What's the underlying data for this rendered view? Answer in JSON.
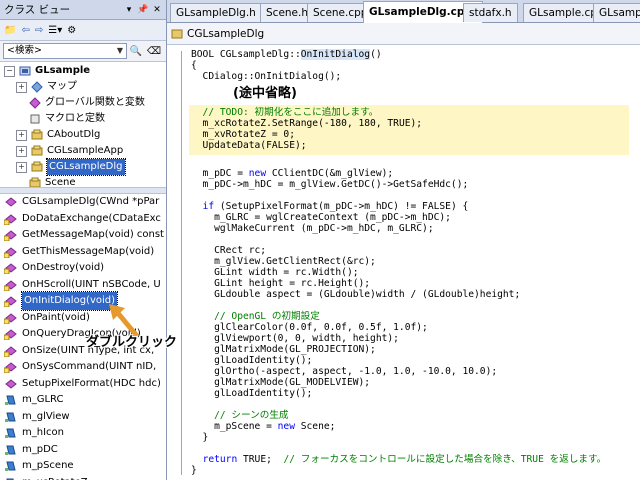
{
  "class_view": {
    "title": "クラス ビュー",
    "search_placeholder": "<検索>",
    "tree": [
      {
        "label": "GLsample",
        "level": 0,
        "expander": "−",
        "icon": "project-icon",
        "bold": true
      },
      {
        "label": "マップ",
        "level": 1,
        "expander": "+",
        "icon": "map-icon"
      },
      {
        "label": "グローバル関数と変数",
        "level": 1,
        "expander": "",
        "icon": "global-functions-icon"
      },
      {
        "label": "マクロと定数",
        "level": 1,
        "expander": "",
        "icon": "macro-icon"
      },
      {
        "label": "CAboutDlg",
        "level": 1,
        "expander": "+",
        "icon": "class-icon"
      },
      {
        "label": "CGLsampleApp",
        "level": 1,
        "expander": "+",
        "icon": "class-icon"
      },
      {
        "label": "CGLsampleDlg",
        "level": 1,
        "expander": "+",
        "icon": "class-icon",
        "selected": true
      },
      {
        "label": "Scene",
        "level": 1,
        "expander": "",
        "icon": "class-icon"
      }
    ],
    "members": [
      {
        "label": "CGLsampleDlg(CWnd *pPar",
        "icon": "method-icon"
      },
      {
        "label": "DoDataExchange(CDataExc",
        "icon": "method-protected-icon"
      },
      {
        "label": "GetMessageMap(void) const",
        "icon": "method-protected-icon"
      },
      {
        "label": "GetThisMessageMap(void)",
        "icon": "method-protected-icon"
      },
      {
        "label": "OnDestroy(void)",
        "icon": "method-protected-icon"
      },
      {
        "label": "OnHScroll(UINT nSBCode, U",
        "icon": "method-protected-icon"
      },
      {
        "label": "OnInitDialog(void)",
        "icon": "method-protected-icon",
        "selected": true
      },
      {
        "label": "OnPaint(void)",
        "icon": "method-protected-icon"
      },
      {
        "label": "OnQueryDragIcon(void)",
        "icon": "method-protected-icon"
      },
      {
        "label": "OnSize(UINT nType, int cx,",
        "icon": "method-protected-icon"
      },
      {
        "label": "OnSysCommand(UINT nID,",
        "icon": "method-protected-icon"
      },
      {
        "label": "SetupPixelFormat(HDC hdc)",
        "icon": "method-icon"
      },
      {
        "label": "m_GLRC",
        "icon": "field-icon"
      },
      {
        "label": "m_glView",
        "icon": "field-icon"
      },
      {
        "label": "m_hIcon",
        "icon": "field-icon"
      },
      {
        "label": "m_pDC",
        "icon": "field-icon"
      },
      {
        "label": "m_pScene",
        "icon": "field-icon"
      },
      {
        "label": "m_xcRotateZ",
        "icon": "field-icon"
      }
    ]
  },
  "tabs": [
    {
      "label": "GLsampleDlg.h",
      "active": false
    },
    {
      "label": "Scene.h",
      "active": false
    },
    {
      "label": "Scene.cpp",
      "active": false
    },
    {
      "label": "GLsampleDlg.cpp*",
      "active": true
    },
    {
      "label": "stdafx.h",
      "active": false
    },
    {
      "label": "GLsample.cpp",
      "active": false
    },
    {
      "label": "GLsample",
      "active": false
    }
  ],
  "nav_bar": {
    "label": "CGLsampleDlg"
  },
  "code_lines": [
    [
      {
        "t": "BOOL CGLsampleDlg::",
        "c": ""
      },
      {
        "t": "OnInitDialog",
        "c": "hl"
      },
      {
        "t": "()",
        "c": ""
      }
    ],
    [
      {
        "t": "{",
        "c": ""
      }
    ],
    [
      {
        "t": "  CDialog::OnInitDialog();",
        "c": ""
      }
    ],
    [
      {
        "t": "",
        "c": ""
      }
    ],
    [
      {
        "t": "",
        "c": ""
      }
    ],
    [
      {
        "t": "  // TODO: 初期化をここに追加します。",
        "c": "cm"
      }
    ],
    [
      {
        "t": "  m_xcRotateZ.SetRange(-180, 180, ",
        "c": ""
      },
      {
        "t": "TRUE",
        "c": ""
      },
      {
        "t": ");",
        "c": ""
      }
    ],
    [
      {
        "t": "  m_xvRotateZ = 0;",
        "c": ""
      }
    ],
    [
      {
        "t": "  UpdateData(FALSE);",
        "c": ""
      }
    ],
    [
      {
        "t": "",
        "c": ""
      }
    ],
    [
      {
        "t": "  m_pDC = ",
        "c": ""
      },
      {
        "t": "new",
        "c": "kw"
      },
      {
        "t": " CClientDC(&m_glView);",
        "c": ""
      }
    ],
    [
      {
        "t": "  m_pDC->m_hDC = m_glView.GetDC()->GetSafeHdc();",
        "c": ""
      }
    ],
    [
      {
        "t": "",
        "c": ""
      }
    ],
    [
      {
        "t": "  ",
        "c": ""
      },
      {
        "t": "if",
        "c": "kw"
      },
      {
        "t": " (SetupPixelFormat(m_pDC->m_hDC) != FALSE) {",
        "c": ""
      }
    ],
    [
      {
        "t": "    m_GLRC = wglCreateContext (m_pDC->m_hDC);",
        "c": ""
      }
    ],
    [
      {
        "t": "    wglMakeCurrent (m_pDC->m_hDC, m_GLRC);",
        "c": ""
      }
    ],
    [
      {
        "t": "",
        "c": ""
      }
    ],
    [
      {
        "t": "    CRect rc;",
        "c": ""
      }
    ],
    [
      {
        "t": "    m_glView.GetClientRect(&rc);",
        "c": ""
      }
    ],
    [
      {
        "t": "    GLint width = rc.Width();",
        "c": ""
      }
    ],
    [
      {
        "t": "    GLint height = rc.Height();",
        "c": ""
      }
    ],
    [
      {
        "t": "    GLdouble aspect = (GLdouble)width / (GLdouble)height;",
        "c": ""
      }
    ],
    [
      {
        "t": "",
        "c": ""
      }
    ],
    [
      {
        "t": "    // OpenGL の初期設定",
        "c": "cm"
      }
    ],
    [
      {
        "t": "    glClearColor(0.0f, 0.0f, 0.5f, 1.0f);",
        "c": ""
      }
    ],
    [
      {
        "t": "    glViewport(0, 0, width, height);",
        "c": ""
      }
    ],
    [
      {
        "t": "    glMatrixMode(GL_PROJECTION);",
        "c": ""
      }
    ],
    [
      {
        "t": "    glLoadIdentity();",
        "c": ""
      }
    ],
    [
      {
        "t": "    glOrtho(-aspect, aspect, -1.0, 1.0, -10.0, 10.0);",
        "c": ""
      }
    ],
    [
      {
        "t": "    glMatrixMode(GL_MODELVIEW);",
        "c": ""
      }
    ],
    [
      {
        "t": "    glLoadIdentity();",
        "c": ""
      }
    ],
    [
      {
        "t": "",
        "c": ""
      }
    ],
    [
      {
        "t": "    // シーンの生成",
        "c": "cm"
      }
    ],
    [
      {
        "t": "    m_pScene = ",
        "c": ""
      },
      {
        "t": "new",
        "c": "kw"
      },
      {
        "t": " Scene;",
        "c": ""
      }
    ],
    [
      {
        "t": "  }",
        "c": ""
      }
    ],
    [
      {
        "t": "",
        "c": ""
      }
    ],
    [
      {
        "t": "  ",
        "c": ""
      },
      {
        "t": "return",
        "c": "kw"
      },
      {
        "t": " TRUE;  ",
        "c": ""
      },
      {
        "t": "// フォーカスをコントロールに設定した場合を除き、TRUE を返します。",
        "c": "cm"
      }
    ],
    [
      {
        "t": "}",
        "c": ""
      }
    ]
  ],
  "annotations": {
    "omitted": "(途中省略)",
    "double_click": "ダブルクリック"
  },
  "colors": {
    "highlight_line": "#fef6c5",
    "selection": "#3167c6",
    "annotation_arrow": "#e69a2e",
    "keyword": "#0000ff",
    "comment": "#008000"
  }
}
